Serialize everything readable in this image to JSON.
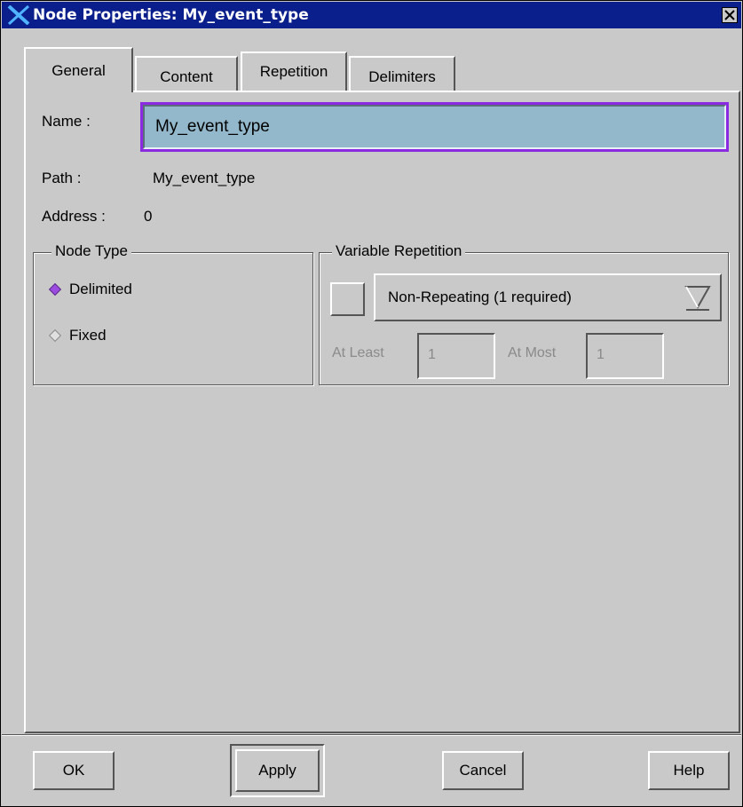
{
  "window": {
    "title": "Node Properties: My_event_type"
  },
  "tabs": [
    {
      "label": "General"
    },
    {
      "label": "Content"
    },
    {
      "label": "Repetition"
    },
    {
      "label": "Delimiters"
    }
  ],
  "general": {
    "name_label": "Name :",
    "name_value": "My_event_type",
    "path_label": "Path :",
    "path_value": "My_event_type",
    "address_label": "Address :",
    "address_value": "0"
  },
  "node_type": {
    "title": "Node Type",
    "options": [
      {
        "label": "Delimited",
        "selected": true
      },
      {
        "label": "Fixed",
        "selected": false
      }
    ]
  },
  "variable_repetition": {
    "title": "Variable Repetition",
    "dropdown_value": "Non-Repeating (1 required)",
    "at_least_label": "At Least",
    "at_least_value": "1",
    "at_most_label": "At Most",
    "at_most_value": "1"
  },
  "buttons": {
    "ok": "OK",
    "apply": "Apply",
    "cancel": "Cancel",
    "help": "Help"
  },
  "colors": {
    "title_bar": "#0a1e8c",
    "focus_border": "#8a2be2",
    "field_background": "#93b8cb",
    "radio_selected": "#9b4be0"
  }
}
